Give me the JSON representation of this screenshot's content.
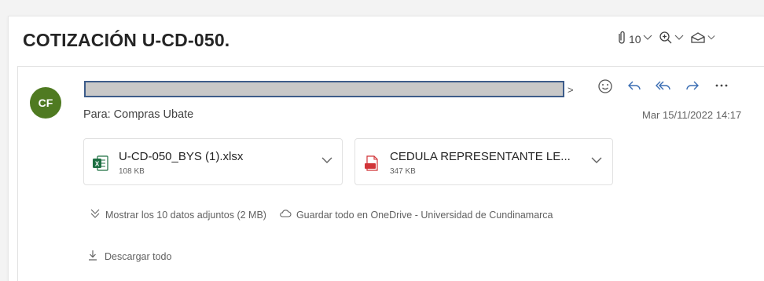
{
  "subject": "COTIZACIÓN U-CD-050.",
  "toolbar": {
    "attachments_count": "10"
  },
  "sender": {
    "initials": "CF",
    "avatar_color": "#4f7a21"
  },
  "to_line": "Para: Compras Ubate",
  "date": "Mar 15/11/2022 14:17",
  "attachments": [
    {
      "name": "U-CD-050_BYS (1).xlsx",
      "size": "108 KB",
      "icon": "excel-file-icon"
    },
    {
      "name": "CEDULA REPRESENTANTE LE...",
      "size": "347 KB",
      "icon": "pdf-file-icon"
    }
  ],
  "show_all_label": "Mostrar los 10 datos adjuntos (2 MB)",
  "save_onedrive_label": "Guardar todo en OneDrive - Universidad de Cundinamarca",
  "download_all_label": "Descargar todo",
  "colors": {
    "accent": "#0f6cbd",
    "excel": "#1d6f42",
    "pdf": "#d13438"
  }
}
